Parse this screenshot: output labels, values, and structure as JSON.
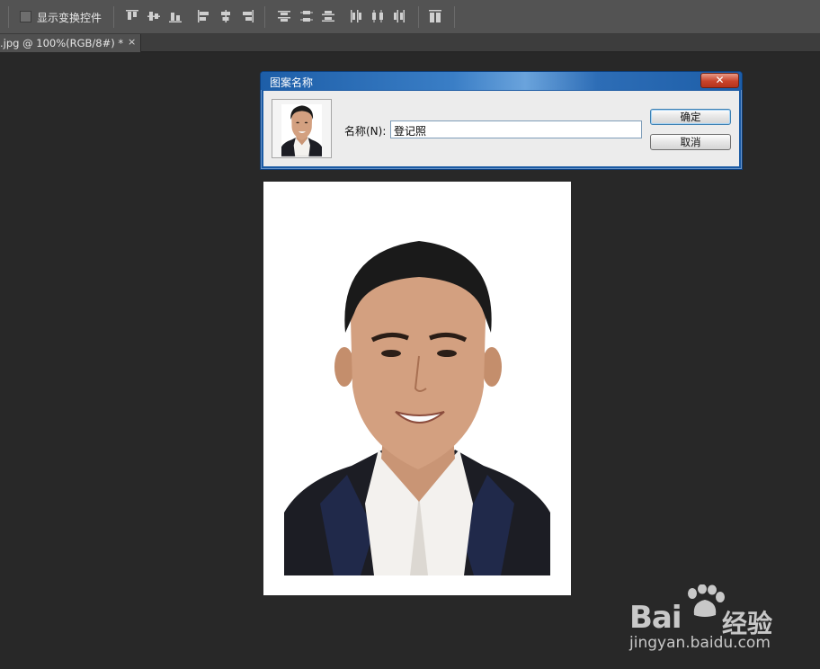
{
  "options_bar": {
    "transform_controls_label": "显示变换控件",
    "transform_controls_checked": false,
    "icons": [
      "align-top-edges-icon",
      "align-vertical-centers-icon",
      "align-bottom-edges-icon",
      "align-left-edges-icon",
      "align-horizontal-centers-icon",
      "align-right-edges-icon",
      "distribute-top-edges-icon",
      "distribute-vertical-centers-icon",
      "distribute-bottom-edges-icon",
      "distribute-left-edges-icon",
      "distribute-horizontal-centers-icon",
      "distribute-right-edges-icon",
      "auto-align-layers-icon"
    ]
  },
  "document_tab": {
    "title": ".jpg @ 100%(RGB/8#) *",
    "close_glyph": "×"
  },
  "dialog": {
    "title": "图案名称",
    "close_glyph": "✕",
    "name_label": "名称(N):",
    "name_value": "登记照",
    "ok_label": "确定",
    "cancel_label": "取消"
  },
  "watermark": {
    "brand": "Bai",
    "brand_suffix": "经验",
    "url": "jingyan.baidu.com"
  },
  "colors": {
    "workspace": "#282828",
    "options_bar": "#535353",
    "dialog_title_blue": "#1d5ea8",
    "close_red": "#c8432b"
  }
}
